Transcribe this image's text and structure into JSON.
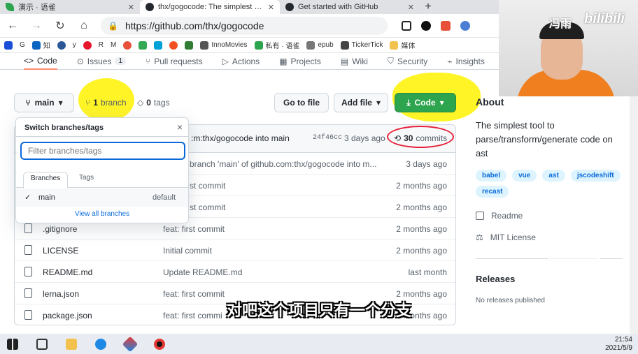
{
  "browser": {
    "tabs": [
      {
        "title": "演示 · 语雀",
        "close": "✕"
      },
      {
        "title": "thx/gogocode: The simplest tool",
        "close": "✕"
      },
      {
        "title": "Get started with GitHub",
        "close": "✕"
      }
    ],
    "new_tab": "+",
    "url": "https://github.com/thx/gogocode",
    "bookmarks": [
      "G",
      "知",
      "y",
      "R",
      "M",
      "InnoMovies",
      "私有 · 语雀",
      "epub",
      "TickerTick",
      "媒体"
    ]
  },
  "repo_nav": {
    "items": [
      {
        "label": "Code",
        "icon": "code-icon"
      },
      {
        "label": "Issues",
        "count": "1",
        "icon": "issue-icon"
      },
      {
        "label": "Pull requests",
        "icon": "pr-icon"
      },
      {
        "label": "Actions",
        "icon": "actions-icon"
      },
      {
        "label": "Projects",
        "icon": "projects-icon"
      },
      {
        "label": "Wiki",
        "icon": "wiki-icon"
      },
      {
        "label": "Security",
        "icon": "shield-icon"
      },
      {
        "label": "Insights",
        "icon": "graph-icon"
      }
    ]
  },
  "toolbar": {
    "branch_button": "main",
    "branch_count": "1",
    "branch_label": "branch",
    "tags_count": "0",
    "tags_label": "tags",
    "go_to_file": "Go to file",
    "add_file": "Add file",
    "code": "Code"
  },
  "commit_bar": {
    "message": ":m:thx/gogocode into main",
    "sha": "24f46cc",
    "age": "3 days ago",
    "count": "30",
    "count_label": "commits"
  },
  "files": [
    {
      "name": "",
      "message": "branch 'main' of github.com:thx/gogocode into m...",
      "age": "3 days ago"
    },
    {
      "name": "",
      "message": "st commit",
      "age": "2 months ago"
    },
    {
      "name": "",
      "message": "st commit",
      "age": "2 months ago"
    },
    {
      "name": ".gitignore",
      "message": "feat: first commit",
      "age": "2 months ago"
    },
    {
      "name": "LICENSE",
      "message": "Initial commit",
      "age": "2 months ago"
    },
    {
      "name": "README.md",
      "message": "Update README.md",
      "age": "last month"
    },
    {
      "name": "lerna.json",
      "message": "feat: first commit",
      "age": "2 months ago"
    },
    {
      "name": "package.json",
      "message": "feat: first commi",
      "age": "2 months ago"
    }
  ],
  "dropdown": {
    "title": "Switch branches/tags",
    "close": "×",
    "filter_placeholder": "Filter branches/tags",
    "tab_branches": "Branches",
    "tab_tags": "Tags",
    "branch_name": "main",
    "branch_default": "default",
    "check": "✓",
    "view_all": "View all branches"
  },
  "about": {
    "title": "About",
    "description": "The simplest tool to parse/transform/generate code on ast",
    "topics": [
      "babel",
      "vue",
      "ast",
      "jscodeshift",
      "recast"
    ],
    "readme": "Readme",
    "license": "MIT License",
    "releases_title": "Releases",
    "releases_sub": "No releases published"
  },
  "overlay": {
    "watermark_name": "冯雨",
    "watermark_logo": "bilibili",
    "subtitle": "对吧这个项目只有一个分支"
  },
  "taskbar": {
    "time": "21:54",
    "date": "2021/5/9"
  }
}
